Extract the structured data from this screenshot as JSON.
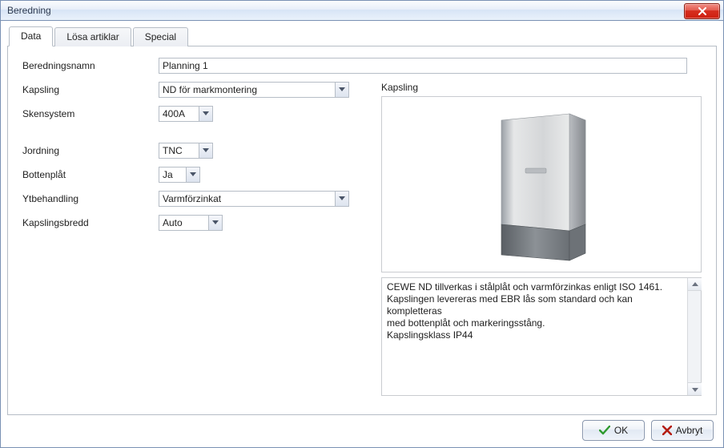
{
  "window": {
    "title": "Beredning"
  },
  "tabs": [
    {
      "label": "Data",
      "active": true
    },
    {
      "label": "Lösa artiklar",
      "active": false
    },
    {
      "label": "Special",
      "active": false
    }
  ],
  "labels": {
    "beredningsnamn": "Beredningsnamn",
    "kapsling": "Kapsling",
    "skensystem": "Skensystem",
    "jordning": "Jordning",
    "bottenplat": "Bottenplåt",
    "ytbehandling": "Ytbehandling",
    "kapslingsbredd": "Kapslingsbredd",
    "group_kapsling": "Kapsling"
  },
  "values": {
    "beredningsnamn": "Planning 1",
    "kapsling": "ND för markmontering",
    "skensystem": "400A",
    "jordning": "TNC",
    "bottenplat": "Ja",
    "ytbehandling": "Varmförzinkat",
    "kapslingsbredd": "Auto"
  },
  "description": "CEWE ND tillverkas i stålplåt och varmförzinkas enligt ISO 1461.\nKapslingen levereras med EBR lås som standard och kan kompletteras\nmed bottenplåt och markeringsstång.\nKapslingsklass IP44",
  "buttons": {
    "ok": "OK",
    "cancel": "Avbryt"
  }
}
